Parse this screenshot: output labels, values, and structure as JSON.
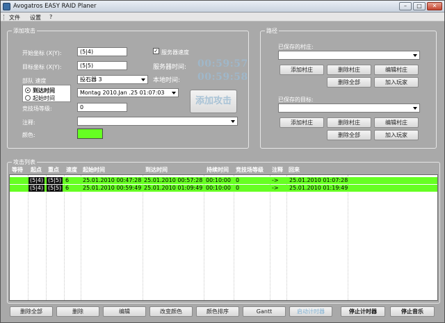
{
  "window": {
    "title": "Avogatros EASY RAID Planer",
    "min": "–",
    "max": "□",
    "close": "✕"
  },
  "menu": {
    "items": [
      "文件",
      "设置",
      "?"
    ]
  },
  "attack_group": {
    "title": "添加攻击",
    "start_label": "开始坐标 (X|Y):",
    "start_value": "(5|4)",
    "target_label": "目标坐标 (X|Y):",
    "target_value": "(5|5)",
    "speed_label": "部队 速度",
    "speed_value": "投石器 3",
    "radio_arrival": "到达时间",
    "radio_departure": "起始时间",
    "datetime_value": "Montag    2010.Jan .25 01:07:03",
    "arena_label": "竞技场等级:",
    "arena_value": "0",
    "note_label": "注释:",
    "note_value": "",
    "color_label": "颜色:",
    "server_speed_check": "服务器速度",
    "server_time_label": "服务器时间:",
    "server_time_value": "00:59:57",
    "local_time_label": "本地时间:",
    "local_time_value": "00:59:58",
    "add_attack_button": "添加攻击",
    "color_value": "#66ff22"
  },
  "path_group": {
    "title": "路径",
    "saved_villages_label": "已保存的村庄:",
    "saved_villages_value": "",
    "saved_targets_label": "已保存的目标:",
    "saved_targets_value": "",
    "btn_add_village": "添加村庄",
    "btn_delete_village": "删除村庄",
    "btn_edit_village": "编辑村庄",
    "btn_delete_all": "删除全部",
    "btn_add_player": "加入玩家"
  },
  "list_group": {
    "title": "攻击列表",
    "columns": [
      "等待",
      "起点",
      "重点",
      "速度",
      "起始时间",
      "到达时间",
      "持续时间",
      "竞技场等级",
      "注释",
      "回来"
    ],
    "rows": [
      {
        "start": "(5|4)",
        "end": "(5|5)",
        "speed": "6",
        "start_time": "25.01.2010 00:47:28",
        "arrive_time": "25.01.2010 00:57:28",
        "duration": "00:10:00",
        "arena": "0",
        "note": "->",
        "return": "25.01.2010 01:07:28"
      },
      {
        "start": "(5|4)",
        "end": "(5|5)",
        "speed": "6",
        "start_time": "25.01.2010 00:59:49",
        "arrive_time": "25.01.2010 01:09:49",
        "duration": "00:10:00",
        "arena": "0",
        "note": "->",
        "return": "25.01.2010 01:19:49"
      }
    ]
  },
  "bottom_buttons": {
    "delete_all": "删除全部",
    "delete": "删除",
    "edit": "编辑",
    "change_color": "改变颜色",
    "color_sort": "颜色排序",
    "gantt": "Gantt",
    "start_timer": "启动计时器",
    "stop_timer": "停止计时器",
    "stop_music": "停止音乐"
  },
  "colors": {
    "row_highlight": "#66ff22",
    "timer": "#9fb7c9"
  }
}
